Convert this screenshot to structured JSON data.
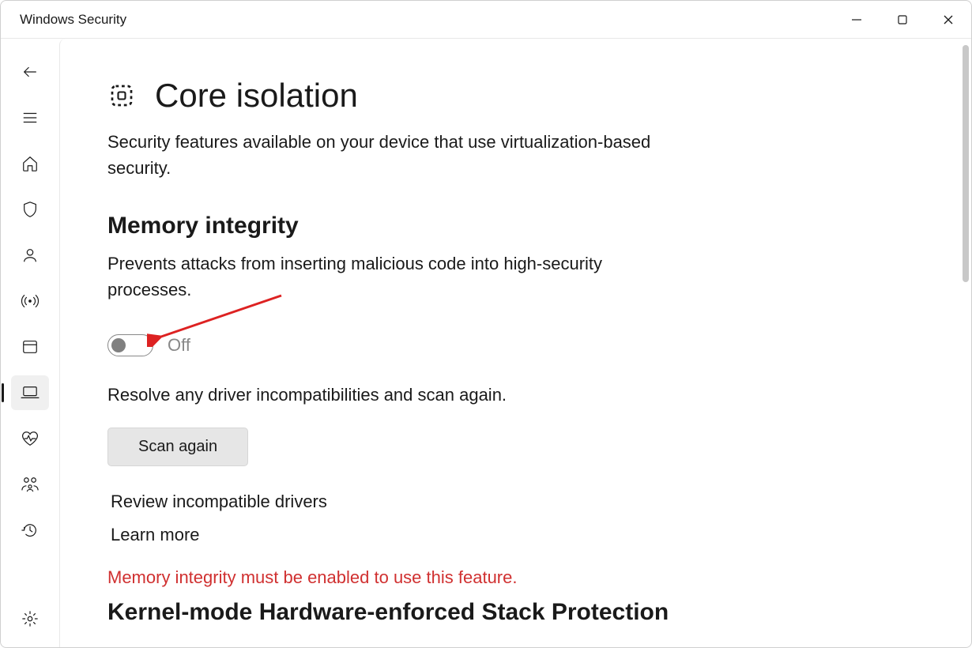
{
  "window": {
    "title": "Windows Security"
  },
  "page": {
    "title": "Core isolation",
    "description": "Security features available on your device that use virtualization-based security."
  },
  "memory_integrity": {
    "title": "Memory integrity",
    "description": "Prevents attacks from inserting malicious code into high-security processes.",
    "toggle_state": "Off",
    "resolve_text": "Resolve any driver incompatibilities and scan again.",
    "scan_button": "Scan again",
    "review_link": "Review incompatible drivers",
    "learn_more": "Learn more"
  },
  "stack_protection": {
    "error": "Memory integrity must be enabled to use this feature.",
    "title": "Kernel-mode Hardware-enforced Stack Protection"
  }
}
